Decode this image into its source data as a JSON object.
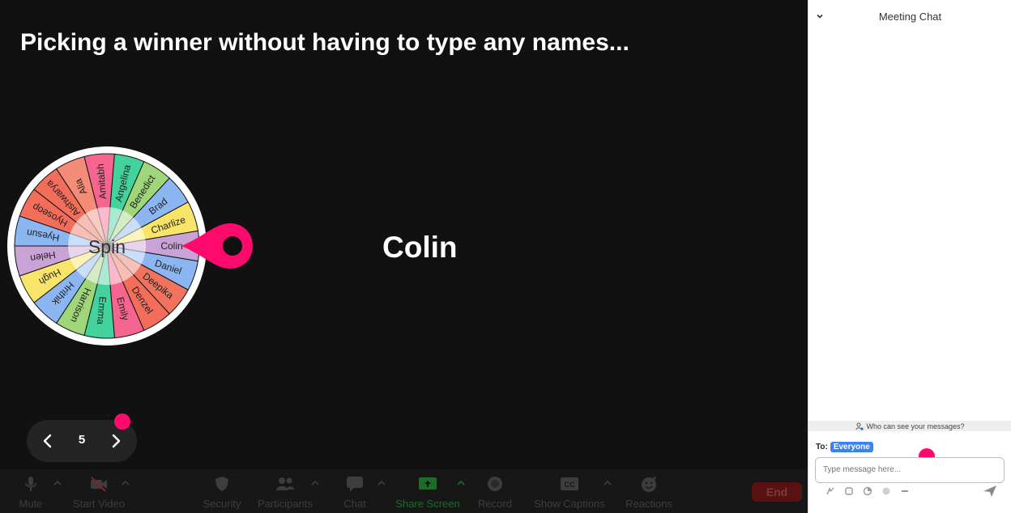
{
  "slide": {
    "title": "Picking a winner without having to type any names...",
    "winner": "Colin",
    "spin_label": "Spin",
    "page_number": "5"
  },
  "wheel": {
    "names": [
      "Colin",
      "Daniel",
      "Deepika",
      "Denzel",
      "Emily",
      "Emma",
      "Harrison",
      "Hrithik",
      "Hugh",
      "Helen",
      "Hyesun",
      "Hyoseop",
      "Aishwarya",
      "Alia",
      "Amitabh",
      "Angelina",
      "Benedict",
      "Brad",
      "Charlize"
    ],
    "colors": [
      "#c9a3d6",
      "#8cb6f2",
      "#f0735e",
      "#f26d5a",
      "#f5658f",
      "#43d19c",
      "#9fd67a",
      "#8cb6f2",
      "#f9e46a",
      "#c9a3d6",
      "#8cb6f2",
      "#f26d5a",
      "#f26d5a",
      "#f48c77",
      "#f5658f",
      "#43d19c",
      "#9fd67a",
      "#8cb6f2",
      "#f9e46a"
    ],
    "pointer_color": "#ff0a6c"
  },
  "toolbar": {
    "items": [
      {
        "name": "mute-button",
        "icon": "microphone-icon",
        "label": "Mute",
        "caret": true
      },
      {
        "name": "start-video-button",
        "icon": "video-off-icon",
        "label": "Start Video",
        "caret": true
      },
      {
        "name": "security-button",
        "icon": "shield-icon",
        "label": "Security",
        "caret": false
      },
      {
        "name": "participants-button",
        "icon": "people-icon",
        "label": "Participants",
        "caret": true
      },
      {
        "name": "chat-button",
        "icon": "chat-bubble-icon",
        "label": "Chat",
        "caret": true
      },
      {
        "name": "share-screen-button",
        "icon": "share-screen-icon",
        "label": "Share Screen",
        "caret": true
      },
      {
        "name": "record-button",
        "icon": "record-icon",
        "label": "Record",
        "caret": false
      },
      {
        "name": "show-captions-button",
        "icon": "cc-icon",
        "label": "Show Captions",
        "caret": true
      },
      {
        "name": "reactions-button",
        "icon": "smiley-icon",
        "label": "Reactions",
        "caret": false
      }
    ],
    "end_label": "End",
    "share_color": "#1f6b2a"
  },
  "chat": {
    "title": "Meeting Chat",
    "who_can_see": "Who can see your messages?",
    "to_label": "To:",
    "recipient": "Everyone",
    "placeholder": "Type message here..."
  }
}
